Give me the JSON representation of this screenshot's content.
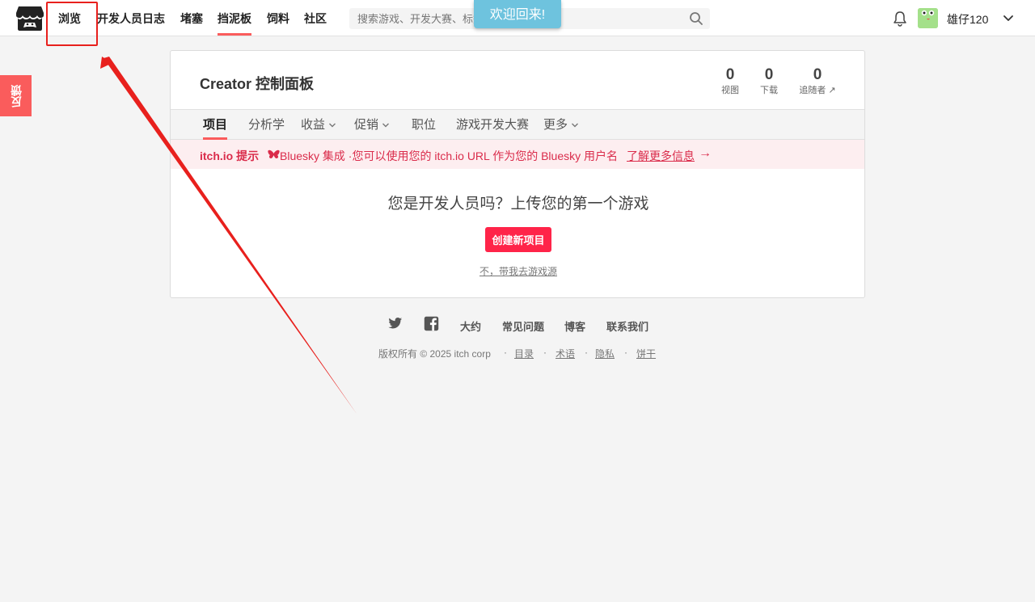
{
  "header": {
    "nav": [
      "浏览",
      "开发人员日志",
      "堵塞",
      "挡泥板",
      "饲料",
      "社区"
    ],
    "search_placeholder": "搜索游戏、开发大赛、标签",
    "username": "雄仔120"
  },
  "welcome": "欢迎回来!",
  "feedback": "反馈",
  "dashboard": {
    "title": "Creator 控制面板",
    "stats": [
      {
        "value": "0",
        "label": "视图"
      },
      {
        "value": "0",
        "label": "下载"
      },
      {
        "value": "0",
        "label": "追随者 ↗"
      }
    ],
    "tabs": [
      "项目",
      "分析学",
      "收益",
      "促销",
      "职位",
      "游戏开发大赛",
      "更多"
    ],
    "notice": {
      "label": "itch.io 提示",
      "text": "Bluesky 集成 ·您可以使用您的 itch.io URL 作为您的 Bluesky 用户名",
      "link": "了解更多信息",
      "arrow": "→"
    },
    "empty_title": "您是开发人员吗？上传您的第一个游戏",
    "create_button": "创建新项目",
    "skip_link": "不，带我去游戏源"
  },
  "footer": {
    "links": [
      "大约",
      "常见问题",
      "博客",
      "联系我们"
    ],
    "copyright": "版权所有 © 2025 itch corp",
    "small_links": [
      "目录",
      "术语",
      "隐私",
      "饼干"
    ]
  },
  "colors": {
    "accent": "#fa5c5c",
    "button": "#ff2449",
    "notice_text": "#da2c4b",
    "welcome_bg": "#6ec3de",
    "annotation": "#e8201d"
  }
}
